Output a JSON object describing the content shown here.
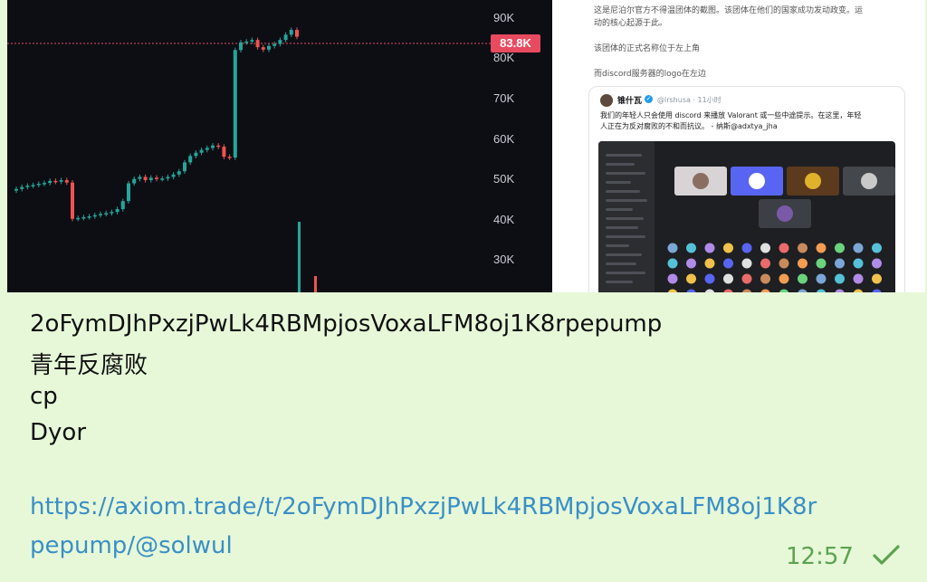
{
  "chart": {
    "y_ticks": [
      "90K",
      "80K",
      "70K",
      "60K",
      "50K",
      "40K",
      "30K"
    ],
    "current_price": "83.8K",
    "colors": {
      "up": "#26a69a",
      "down": "#ef5350",
      "bg": "#0c0e14",
      "price_line": "#e84a5f"
    }
  },
  "post": {
    "lines": [
      "这是尼泊尔官方不得温团体的截图。该团体在他们的国家成功发动政变。运",
      "动的核心起源于此。",
      "该团体的正式名称位于左上角",
      "而discord服务器的logo在左边"
    ],
    "quote": {
      "name": "锥什瓦",
      "handle": "@lrshusa · 11小时",
      "text": [
        "我们的年轻人只会使用 discord 来播放 Valorant 或一些中途提示。在这里，年轻",
        "人正在为反对腐败的不和而抗议。 - 纳斯@adxtya_jha"
      ]
    }
  },
  "message": {
    "lines": [
      "2oFymDJhPxzjPwLk4RBMpjosVoxaLFM8oj1K8rpepump",
      "青年反腐败",
      "cp",
      "Dyor"
    ],
    "link_lines": [
      "https://axiom.trade/t/2oFymDJhPxzjPwLk4RBMpjosVoxaLFM8oj1K8r",
      "pepump/@solwul"
    ],
    "time": "12:57",
    "status_icon": "double-check-icon"
  }
}
